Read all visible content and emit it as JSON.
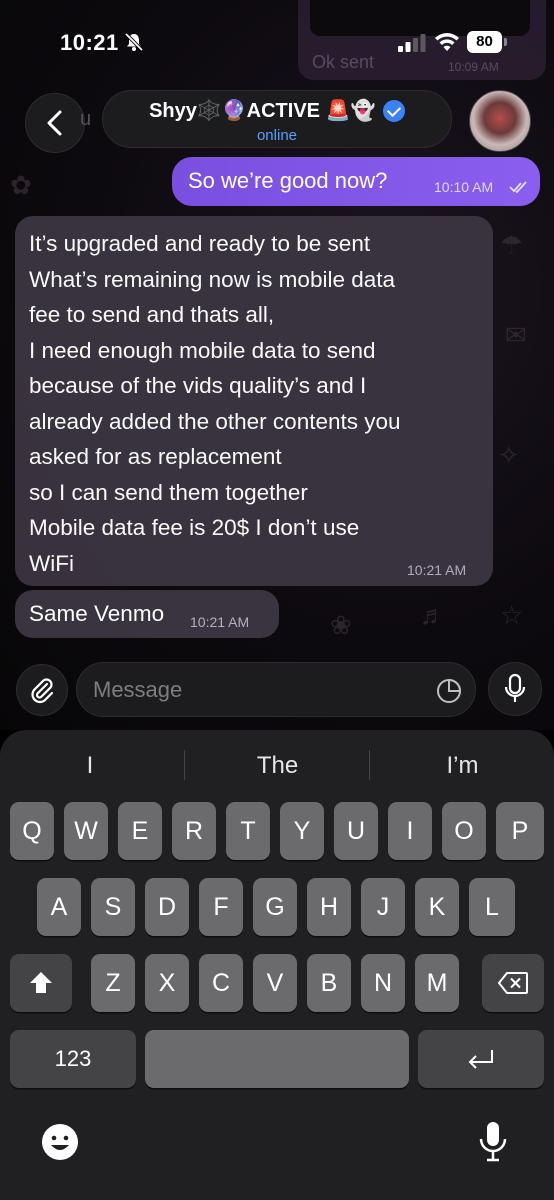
{
  "status_bar": {
    "time": "10:21",
    "battery": "80"
  },
  "ghost": {
    "top_text": "Ok sent",
    "top_time": "10:09 AM",
    "left_text": "u"
  },
  "header": {
    "title": "Shyy🕸️🔮ACTIVE 🚨👻",
    "status": "online"
  },
  "messages": {
    "outgoing": {
      "text": "So we’re good now?",
      "time": "10:10 AM"
    },
    "incoming": {
      "lines": [
        "It’s upgraded and ready to be sent",
        "What’s remaining now is mobile data",
        "fee to send and thats all,",
        "I need enough mobile data to send",
        "because of the vids quality’s and I",
        "already added the other contents you",
        "asked for as replacement",
        "so I can send them together",
        "Mobile data fee is 20$ I don’t use",
        "WiFi"
      ],
      "time": "10:21 AM"
    },
    "incoming2": {
      "text": "Same Venmo",
      "time": "10:21 AM"
    }
  },
  "composer": {
    "placeholder": "Message"
  },
  "keyboard": {
    "suggestions": [
      "I",
      "The",
      "I’m"
    ],
    "row1": [
      "Q",
      "W",
      "E",
      "R",
      "T",
      "Y",
      "U",
      "I",
      "O",
      "P"
    ],
    "row2": [
      "A",
      "S",
      "D",
      "F",
      "G",
      "H",
      "J",
      "K",
      "L"
    ],
    "row3": [
      "Z",
      "X",
      "C",
      "V",
      "B",
      "N",
      "M"
    ],
    "numbers_label": "123"
  }
}
